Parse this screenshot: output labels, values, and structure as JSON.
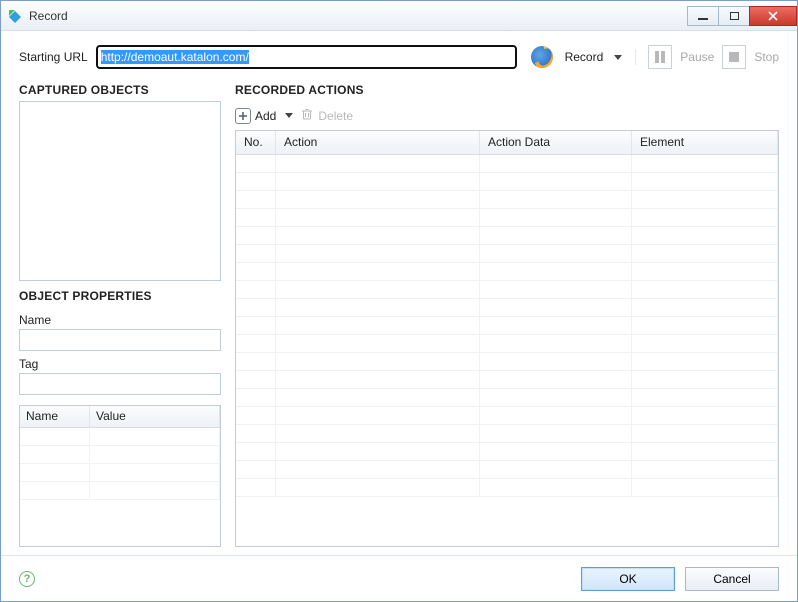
{
  "window": {
    "title": "Record"
  },
  "toolbar": {
    "starting_url_label": "Starting URL",
    "starting_url_value": "http://demoaut.katalon.com/",
    "record_label": "Record",
    "pause_label": "Pause",
    "stop_label": "Stop"
  },
  "captured": {
    "heading": "CAPTURED OBJECTS"
  },
  "properties": {
    "heading": "OBJECT PROPERTIES",
    "name_label": "Name",
    "name_value": "",
    "tag_label": "Tag",
    "tag_value": "",
    "cols": {
      "name": "Name",
      "value": "Value"
    }
  },
  "actions": {
    "heading": "RECORDED ACTIONS",
    "add_label": "Add",
    "delete_label": "Delete",
    "cols": {
      "no": "No.",
      "action": "Action",
      "data": "Action Data",
      "element": "Element"
    }
  },
  "footer": {
    "ok": "OK",
    "cancel": "Cancel"
  }
}
